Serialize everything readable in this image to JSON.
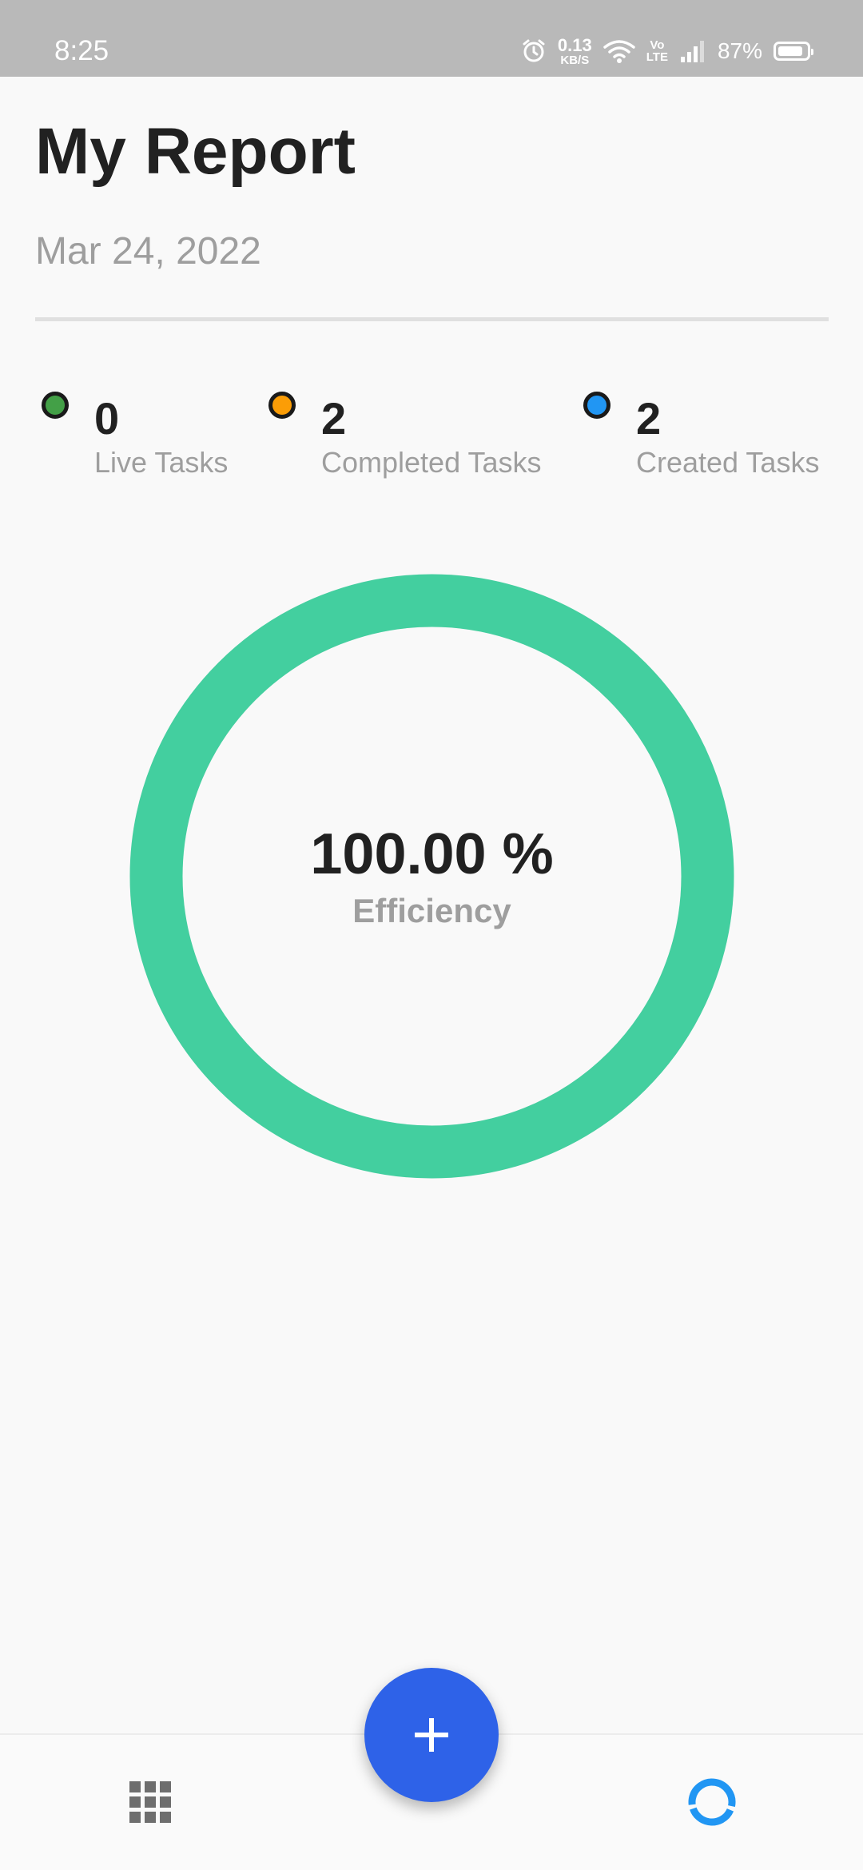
{
  "status_bar": {
    "time": "8:25",
    "net_speed_value": "0.13",
    "net_speed_unit": "KB/S",
    "volte_top": "Vo",
    "volte_bottom": "LTE",
    "battery_percent": "87%",
    "battery_level": 0.87,
    "icons": [
      "alarm-icon",
      "wifi-icon",
      "signal-icon",
      "battery-icon"
    ]
  },
  "header": {
    "title": "My Report",
    "date": "Mar 24, 2022"
  },
  "stats": [
    {
      "count": "0",
      "label": "Live Tasks",
      "color": "#43a047"
    },
    {
      "count": "2",
      "label": "Completed Tasks",
      "color": "#fb9d06"
    },
    {
      "count": "2",
      "label": "Created Tasks",
      "color": "#2196f3"
    }
  ],
  "efficiency": {
    "value": "100.00 %",
    "label": "Efficiency",
    "fraction": 1.0,
    "ring_color": "#43cf9f"
  },
  "bottom_nav": {
    "left_icon": "grid-icon",
    "center_icon": "plus-icon",
    "right_icon": "report-ring-icon",
    "accent_color": "#2e62e8",
    "active_color": "#2196f3"
  }
}
